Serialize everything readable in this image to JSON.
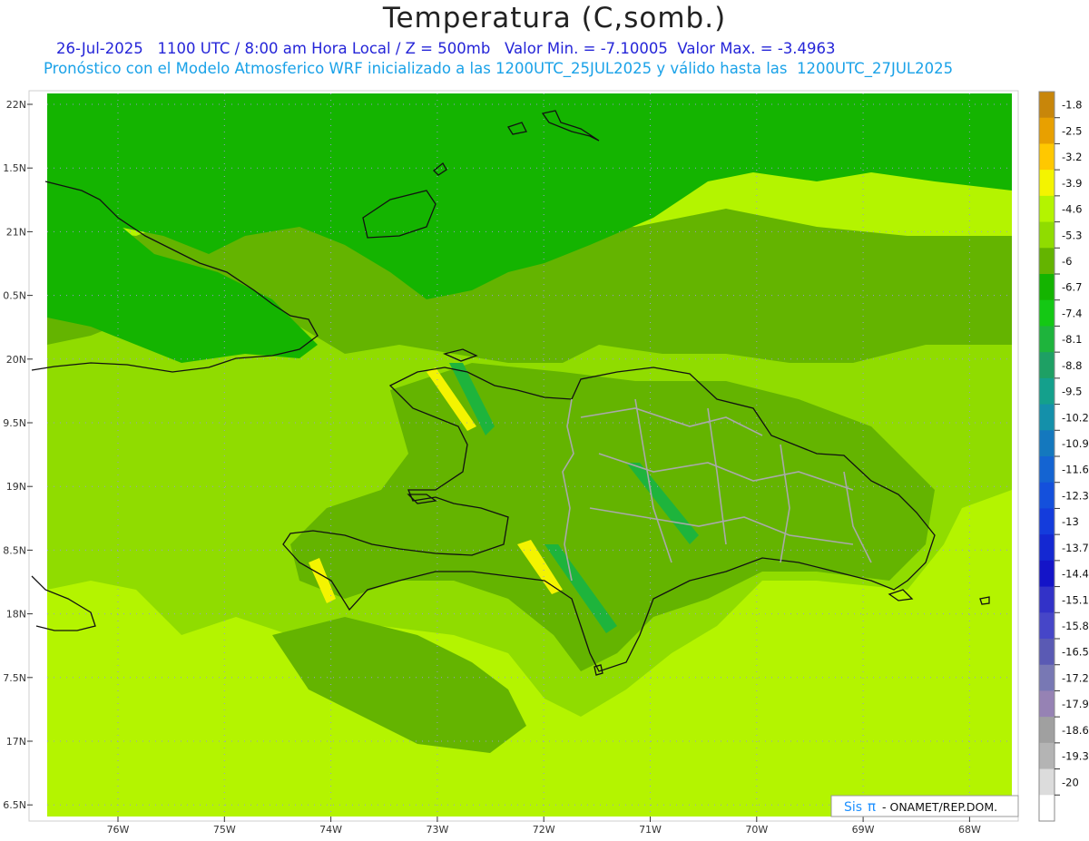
{
  "title": "Temperatura (C,somb.)",
  "subtitle_line1": "26-Jul-2025   1100 UTC / 8:00 am Hora Local / Z = 500mb   Valor Min. = -7.10005  Valor Max. = -3.4963",
  "subtitle_line2": "Pronóstico con el Modelo Atmosferico WRF inicializado a las 1200UTC_25JUL2025 y válido hasta las  1200UTC_27JUL2025",
  "lat_labels": [
    "22N",
    "1.5N",
    "21N",
    "0.5N",
    "20N",
    "9.5N",
    "19N",
    "8.5N",
    "18N",
    "7.5N",
    "17N",
    "6.5N"
  ],
  "lon_labels": [
    "76W",
    "75W",
    "74W",
    "73W",
    "72W",
    "71W",
    "70W",
    "69W",
    "68W"
  ],
  "colorbar": {
    "labels": [
      "-1.8",
      "-2.5",
      "-3.2",
      "-3.9",
      "-4.6",
      "-5.3",
      "-6",
      "-6.7",
      "-7.4",
      "-8.1",
      "-8.8",
      "-9.5",
      "-10.2",
      "-10.9",
      "-11.6",
      "-12.3",
      "-13",
      "-13.7",
      "-14.4",
      "-15.1",
      "-15.8",
      "-16.5",
      "-17.2",
      "-17.9",
      "-18.6",
      "-19.3",
      "-20"
    ],
    "colors": [
      "#c8860a",
      "#e8a000",
      "#ffc800",
      "#f4f400",
      "#b4f400",
      "#90dc00",
      "#64b400",
      "#14b400",
      "#14c814",
      "#1eb43c",
      "#1ea064",
      "#14a08c",
      "#1490aa",
      "#1478be",
      "#1464d2",
      "#1450dc",
      "#143cdc",
      "#1428d2",
      "#1414c8",
      "#3232c8",
      "#4646c8",
      "#5a5ab4",
      "#7878b4",
      "#9682b4",
      "#a0a0a0",
      "#b4b4b4",
      "#dcdcdc",
      "#ffffff"
    ]
  },
  "legend": {
    "brand_sis": "Sis",
    "brand_pi": "π",
    "brand_org": "- ONAMET/REP.DOM."
  },
  "field": {
    "colors": {
      "dark_green": "#14b400",
      "olive_green": "#64b400",
      "mid_green": "#90dc00",
      "light_green": "#b4f400",
      "yellow": "#f4f400",
      "teal_green": "#1eb43c"
    }
  }
}
